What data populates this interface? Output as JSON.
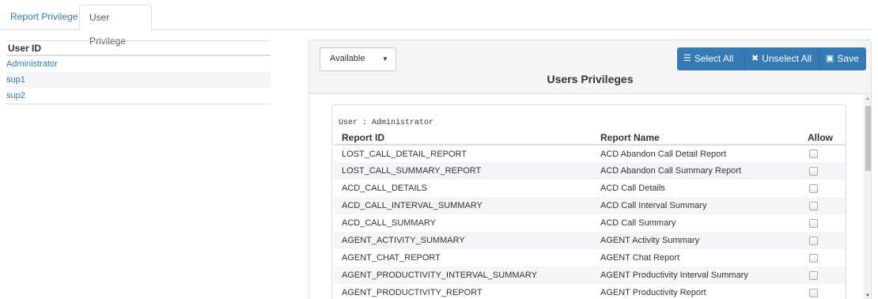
{
  "tabs": [
    {
      "label": "Report Privilege",
      "active": false
    },
    {
      "label": "User Privilege",
      "active": true
    }
  ],
  "user_list": {
    "header": "User ID",
    "users": [
      "Administrator",
      "sup1",
      "sup2"
    ]
  },
  "panel": {
    "filter": {
      "selected": "Available"
    },
    "title": "Users Privileges",
    "buttons": {
      "select_all": "Select All",
      "unselect_all": "Unselect All",
      "save": "Save"
    },
    "user_line": "User : Administrator",
    "columns": [
      "Report ID",
      "Report Name",
      "Allow"
    ],
    "rows": [
      {
        "id": "LOST_CALL_DETAIL_REPORT",
        "name": "ACD Abandon Call Detail Report",
        "allow": false
      },
      {
        "id": "LOST_CALL_SUMMARY_REPORT",
        "name": "ACD Abandon Call Summary Report",
        "allow": false
      },
      {
        "id": "ACD_CALL_DETAILS",
        "name": "ACD Call Details",
        "allow": false
      },
      {
        "id": "ACD_CALL_INTERVAL_SUMMARY",
        "name": "ACD Call Interval Summary",
        "allow": false
      },
      {
        "id": "ACD_CALL_SUMMARY",
        "name": "ACD Call Summary",
        "allow": false
      },
      {
        "id": "AGENT_ACTIVITY_SUMMARY",
        "name": "AGENT Activity Summary",
        "allow": false
      },
      {
        "id": "AGENT_CHAT_REPORT",
        "name": "AGENT Chat Report",
        "allow": false
      },
      {
        "id": "AGENT_PRODUCTIVITY_INTERVAL_SUMMARY",
        "name": "AGENT Productivity Interval Summary",
        "allow": false
      },
      {
        "id": "AGENT_PRODUCTIVITY_REPORT",
        "name": "AGENT Productivity Report",
        "allow": false
      }
    ]
  },
  "colors": {
    "accent": "#337ab7",
    "alt_row": "#f3f5f8"
  }
}
